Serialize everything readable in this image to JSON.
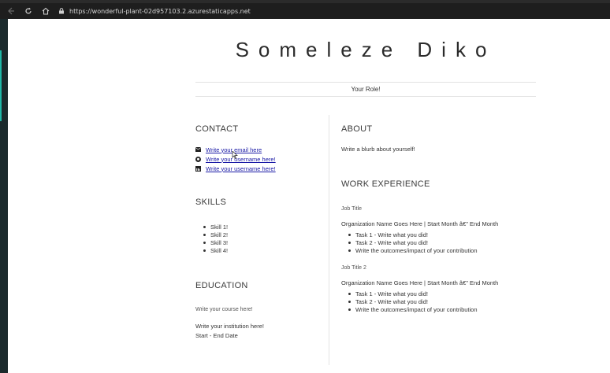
{
  "browser": {
    "url": "https://wonderful-plant-02d957103.2.azurestaticapps.net"
  },
  "resume": {
    "name": "Someleze Diko",
    "role": "Your Role!",
    "contact": {
      "heading": "CONTACT",
      "items": [
        {
          "icon": "email-icon",
          "text": "Write your email here"
        },
        {
          "icon": "github-icon",
          "text": "Write your username here!"
        },
        {
          "icon": "linkedin-icon",
          "text": "Write your username here!"
        }
      ]
    },
    "skills": {
      "heading": "SKILLS",
      "items": [
        "Skill 1!",
        "Skill 2!",
        "Skill 3!",
        "Skill 4!"
      ]
    },
    "education": {
      "heading": "EDUCATION",
      "course": "Write your course here!",
      "institution": "Write your institution here!",
      "dates": "Start - End Date"
    },
    "about": {
      "heading": "ABOUT",
      "blurb": "Write a blurb about yourself!"
    },
    "work": {
      "heading": "WORK EXPERIENCE",
      "jobs": [
        {
          "title": "Job Title",
          "org": "Organization Name Goes Here | Start Month â€\" End Month",
          "tasks": [
            "Task 1 - Write what you did!",
            "Task 2 - Write what you did!",
            "Write the outcomes/impact of your contribution"
          ]
        },
        {
          "title": "Job Title 2",
          "org": "Organization Name Goes Here | Start Month â€\" End Month",
          "tasks": [
            "Task 1 - Write what you did!",
            "Task 2 - Write what you did!",
            "Write the outcomes/impact of your contribution"
          ]
        }
      ]
    }
  }
}
